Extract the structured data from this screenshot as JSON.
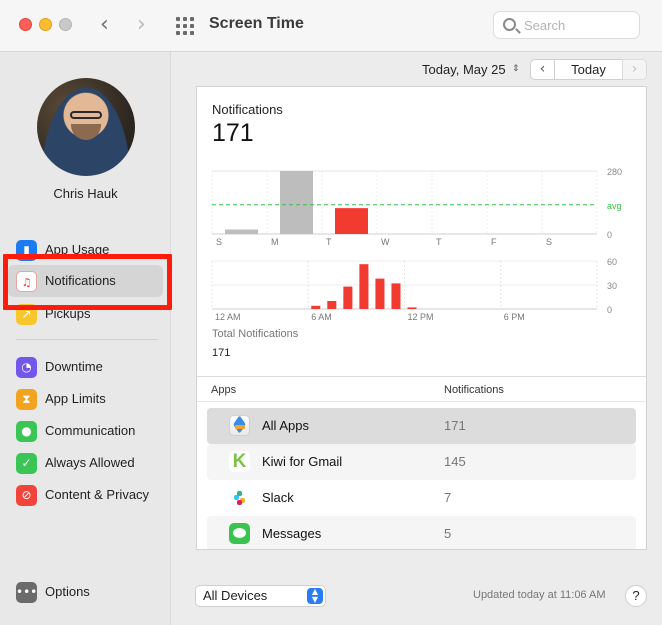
{
  "window": {
    "title": "Screen Time",
    "search_placeholder": "Search"
  },
  "user": {
    "name": "Chris Hauk"
  },
  "sidebar": {
    "items": [
      {
        "label": "App Usage",
        "icon": "bar-chart-icon"
      },
      {
        "label": "Notifications",
        "icon": "bell-icon"
      },
      {
        "label": "Pickups",
        "icon": "pickup-icon"
      },
      {
        "label": "Downtime",
        "icon": "moon-clock-icon"
      },
      {
        "label": "App Limits",
        "icon": "hourglass-icon"
      },
      {
        "label": "Communication",
        "icon": "person-circle-icon"
      },
      {
        "label": "Always Allowed",
        "icon": "checkmark-icon"
      },
      {
        "label": "Content & Privacy",
        "icon": "prohibited-icon"
      }
    ],
    "options_label": "Options",
    "selected": "Notifications"
  },
  "date_bar": {
    "date": "Today, May 25",
    "today_label": "Today"
  },
  "panel": {
    "title": "Notifications",
    "count": "171",
    "total_label": "Total Notifications",
    "total_value": "171"
  },
  "chart_data": [
    {
      "type": "bar",
      "categories": [
        "S",
        "M",
        "T",
        "W",
        "T",
        "F",
        "S"
      ],
      "values": [
        20,
        280,
        115,
        0,
        0,
        0,
        0
      ],
      "highlight_index": 2,
      "ylim": [
        0,
        280
      ],
      "yticks": [
        "280",
        "avg",
        "0"
      ],
      "avg_value": 130,
      "colors": {
        "normal": "#bdbdbd",
        "today": "#f23b30",
        "avg": "#3cbf4a"
      }
    },
    {
      "type": "bar",
      "x_labels": [
        "12 AM",
        "6 AM",
        "12 PM",
        "6 PM"
      ],
      "hours": [
        0,
        1,
        2,
        3,
        4,
        5,
        6,
        7,
        8,
        9,
        10,
        11,
        12,
        13,
        14,
        15,
        16,
        17,
        18,
        19,
        20,
        21,
        22,
        23
      ],
      "values": [
        0,
        0,
        0,
        0,
        0,
        0,
        4,
        10,
        28,
        56,
        38,
        32,
        2,
        0,
        0,
        0,
        0,
        0,
        0,
        0,
        0,
        0,
        0,
        0
      ],
      "ylim": [
        0,
        60
      ],
      "yticks": [
        "60",
        "30",
        "0"
      ],
      "color": "#f23b30"
    }
  ],
  "table": {
    "headers": {
      "apps": "Apps",
      "notifications": "Notifications"
    },
    "rows": [
      {
        "name": "All Apps",
        "count": "171"
      },
      {
        "name": "Kiwi for Gmail",
        "count": "145"
      },
      {
        "name": "Slack",
        "count": "7"
      },
      {
        "name": "Messages",
        "count": "5"
      }
    ]
  },
  "footer": {
    "device": "All Devices",
    "updated": "Updated today at 11:06 AM",
    "help": "?"
  }
}
